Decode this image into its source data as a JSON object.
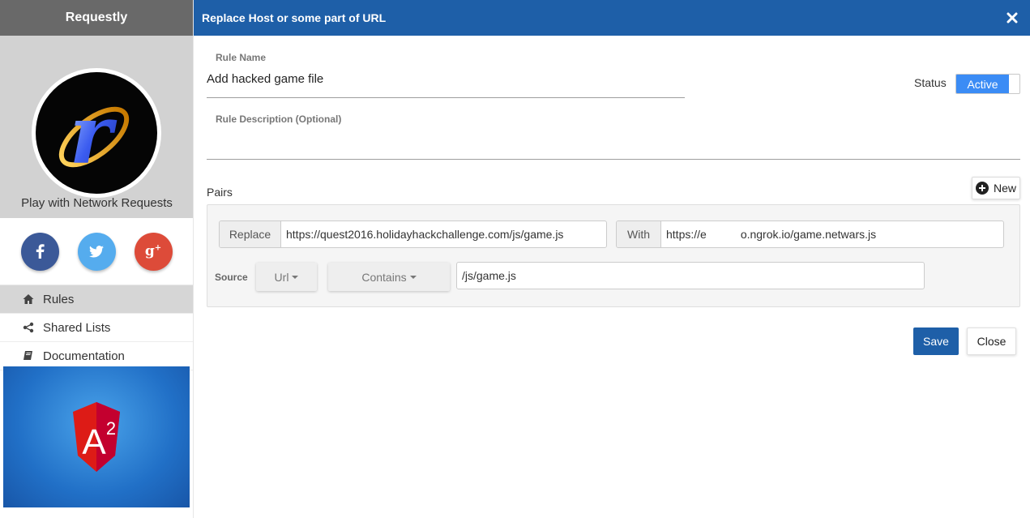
{
  "sidebar": {
    "app_title": "Requestly",
    "tagline": "Play with Network Requests",
    "social": [
      {
        "icon": "facebook-icon",
        "glyph": "f",
        "color": "#3b5998"
      },
      {
        "icon": "twitter-icon",
        "glyph": "t",
        "color": "#55acee"
      },
      {
        "icon": "google-plus-icon",
        "glyph": "g+",
        "color": "#dd4b39"
      }
    ],
    "nav": [
      {
        "label": "Rules",
        "icon": "home-icon"
      },
      {
        "label": "Shared Lists",
        "icon": "share-icon"
      },
      {
        "label": "Documentation",
        "icon": "book-icon"
      }
    ],
    "ad": {
      "badge": "A",
      "superscript": "2"
    }
  },
  "modal": {
    "title": "Replace Host or some part of URL",
    "rule_name_label": "Rule Name",
    "rule_name_value": "Add hacked game file",
    "description_label": "Rule Description (Optional)",
    "description_value": "",
    "status_label": "Status",
    "status_value": "Active",
    "pairs_label": "Pairs",
    "new_button": "New",
    "pair": {
      "replace_label": "Replace",
      "replace_value": "https://quest2016.holidayhackchallenge.com/js/game.js",
      "with_label": "With",
      "with_value_prefix": "https://e",
      "with_value_suffix": "o.ngrok.io/game.netwars.js",
      "source_label": "Source",
      "source_key": "Url",
      "source_operator": "Contains",
      "source_value": "/js/game.js"
    },
    "save_button": "Save",
    "close_button": "Close"
  },
  "colors": {
    "header_blue": "#1e5fa8",
    "active_toggle": "#3b8cf5",
    "sidebar_header": "#696969"
  }
}
